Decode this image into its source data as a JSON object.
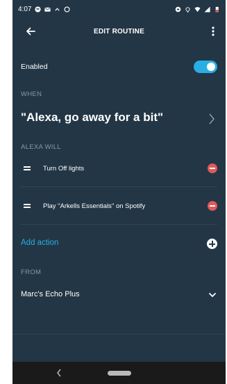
{
  "status_bar": {
    "time": "4:07"
  },
  "header": {
    "title": "EDIT ROUTINE"
  },
  "enabled": {
    "label": "Enabled",
    "value": true
  },
  "when": {
    "section_label": "WHEN",
    "phrase": "\"Alexa, go away for a bit\""
  },
  "alexa_will": {
    "section_label": "ALEXA WILL",
    "actions": [
      {
        "label": "Turn Off lights"
      },
      {
        "label": "Play \"Arkells Essentials\" on Spotify"
      }
    ],
    "add_action_label": "Add action"
  },
  "from": {
    "section_label": "FROM",
    "device": "Marc's Echo Plus"
  },
  "colors": {
    "background": "#233645",
    "accent": "#29aee3",
    "remove": "#e05a5a",
    "section_text": "#7f9bb0"
  },
  "icons": [
    "back-arrow-icon",
    "more-vert-icon",
    "chevron-right-icon",
    "drag-handle-icon",
    "remove-icon",
    "add-icon",
    "chevron-down-icon"
  ]
}
